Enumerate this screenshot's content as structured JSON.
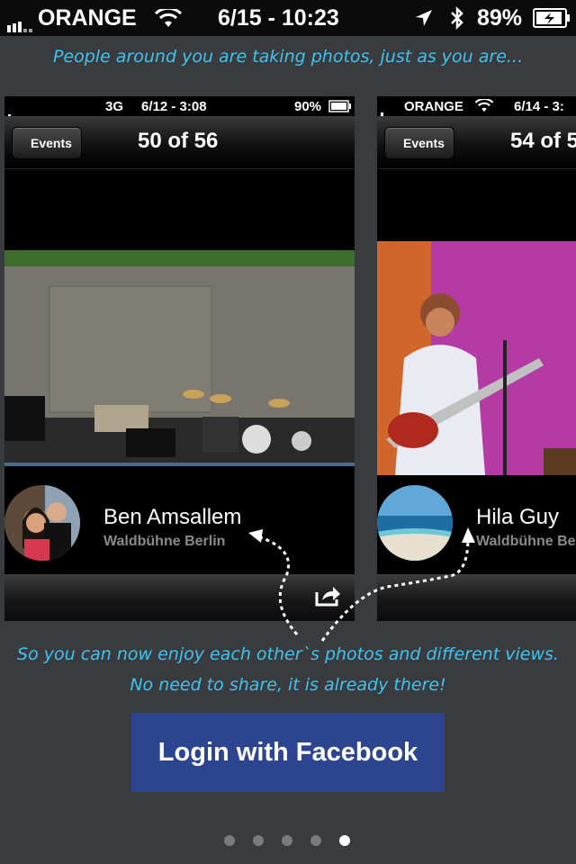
{
  "status_bar": {
    "carrier": "ORANGE",
    "time": "6/15 - 10:23",
    "battery": "89%"
  },
  "headline": "People around you are taking photos, just as you are...",
  "cards": [
    {
      "status": {
        "network": "3G",
        "time": "6/12 - 3:08",
        "battery": "90%"
      },
      "back_label": "Events",
      "counter": "50 of 56",
      "name": "Ben Amsallem",
      "location": "Waldbühne Berlin"
    },
    {
      "status": {
        "carrier": "ORANGE",
        "time": "6/14 - 3:"
      },
      "back_label": "Events",
      "counter": "54 of 5",
      "name": "Hila Guy",
      "location": "Waldbühne Be"
    }
  ],
  "caption_line1": "So you can now enjoy each other`s photos and different views.",
  "caption_line2": "No need to share, it is already there!",
  "login_label": "Login with Facebook",
  "pager": {
    "count": 5,
    "active": 5
  },
  "colors": {
    "accent": "#3ec4ef",
    "facebook": "#2d4591",
    "background": "#3a3b3e"
  }
}
